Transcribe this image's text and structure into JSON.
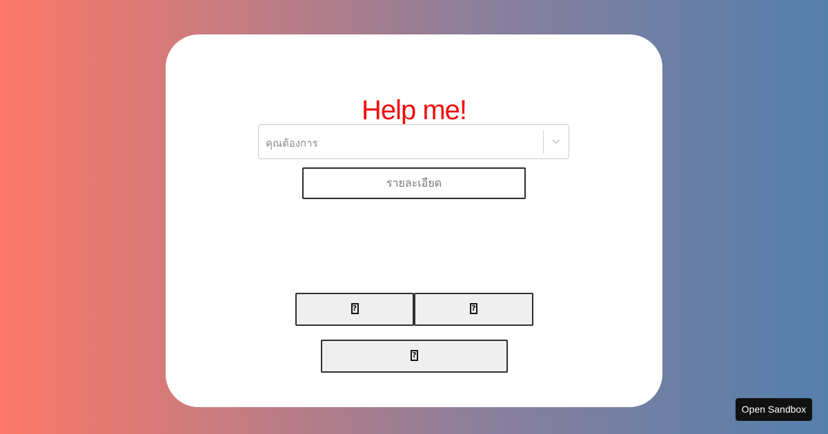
{
  "page": {
    "title": "Help me!",
    "title_color": "#f20d0d",
    "background_gradient": [
      "#fd7868",
      "#547fad"
    ]
  },
  "form": {
    "select": {
      "placeholder": "คุณต้องการ",
      "icon": "chevron-down-icon"
    },
    "detail_input": {
      "placeholder": "รายละเอียด"
    }
  },
  "buttons": [
    {
      "label": "",
      "icon": "missing-glyph-icon"
    },
    {
      "label": "",
      "icon": "missing-glyph-icon"
    },
    {
      "label": "",
      "icon": "missing-glyph-icon"
    }
  ],
  "footer": {
    "sandbox_label": "Open Sandbox"
  }
}
